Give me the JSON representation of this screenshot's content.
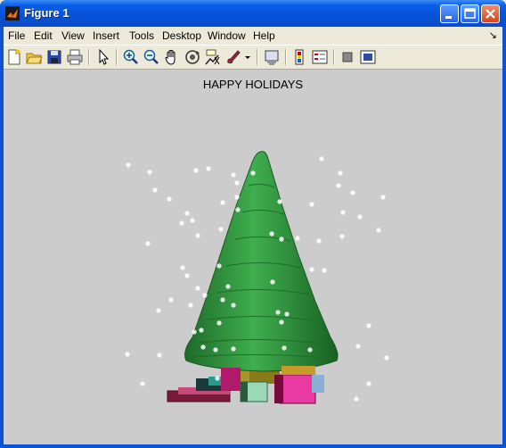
{
  "window": {
    "title": "Figure 1",
    "title_icon": "matlab-logo-icon",
    "controls": [
      "minimize",
      "maximize",
      "close"
    ]
  },
  "menu": {
    "items": [
      "File",
      "Edit",
      "View",
      "Insert",
      "Tools",
      "Desktop",
      "Window",
      "Help"
    ],
    "dock_arrow": "↘"
  },
  "toolbar": {
    "tools": [
      "new-figure-icon",
      "open-file-icon",
      "save-icon",
      "print-icon",
      "edit-plot-arrow-icon",
      "zoom-in-icon",
      "zoom-out-icon",
      "pan-hand-icon",
      "rotate-3d-icon",
      "data-cursor-icon",
      "brush-icon",
      "brush-dropdown-icon",
      "link-plot-icon",
      "colorbar-icon",
      "legend-icon",
      "hide-plot-tools-icon",
      "show-plot-tools-icon"
    ]
  },
  "figure": {
    "title": "HAPPY HOLIDAYS",
    "background": "#cccccc",
    "tree_color": "#2e8b3a",
    "trunk_color": "#8a7a1a"
  }
}
